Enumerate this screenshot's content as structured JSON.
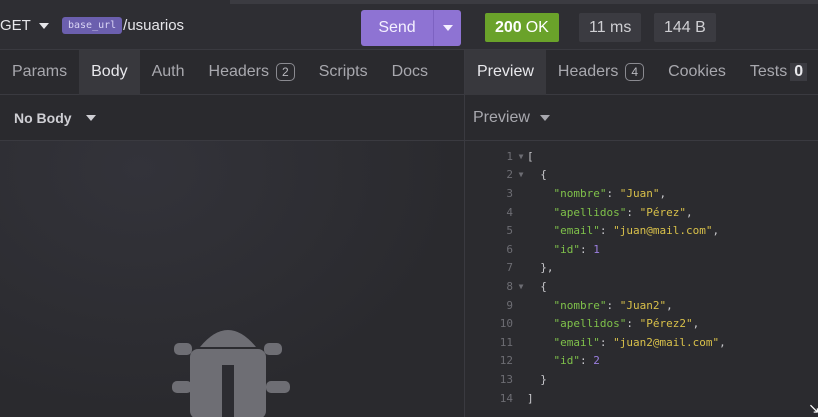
{
  "request": {
    "method": "GET",
    "url_variable": "base_url",
    "url_path": "/usuarios",
    "send_label": "Send"
  },
  "response": {
    "status_code": "200",
    "status_text": "OK",
    "time": "11 ms",
    "size": "144 B"
  },
  "left_tabs": [
    {
      "label": "Params",
      "badge": ""
    },
    {
      "label": "Body",
      "badge": ""
    },
    {
      "label": "Auth",
      "badge": ""
    },
    {
      "label": "Headers",
      "badge": "2"
    },
    {
      "label": "Scripts",
      "badge": ""
    },
    {
      "label": "Docs",
      "badge": ""
    }
  ],
  "right_tabs": [
    {
      "label": "Preview",
      "badge": ""
    },
    {
      "label": "Headers",
      "badge": "4"
    },
    {
      "label": "Cookies",
      "badge": ""
    },
    {
      "label": "Tests",
      "badge": "0"
    }
  ],
  "body_type": "No Body",
  "preview_mode": "Preview",
  "code_lines": [
    {
      "n": "1",
      "fold": true,
      "t": "["
    },
    {
      "n": "2",
      "fold": true,
      "t": "  {"
    },
    {
      "n": "3",
      "fold": false,
      "t": "    \"nombre\": \"Juan\","
    },
    {
      "n": "4",
      "fold": false,
      "t": "    \"apellidos\": \"Pérez\","
    },
    {
      "n": "5",
      "fold": false,
      "t": "    \"email\": \"juan@mail.com\","
    },
    {
      "n": "6",
      "fold": false,
      "t": "    \"id\": 1"
    },
    {
      "n": "7",
      "fold": false,
      "t": "  },"
    },
    {
      "n": "8",
      "fold": true,
      "t": "  {"
    },
    {
      "n": "9",
      "fold": false,
      "t": "    \"nombre\": \"Juan2\","
    },
    {
      "n": "10",
      "fold": false,
      "t": "    \"apellidos\": \"Pérez2\","
    },
    {
      "n": "11",
      "fold": false,
      "t": "    \"email\": \"juan2@mail.com\","
    },
    {
      "n": "12",
      "fold": false,
      "t": "    \"id\": 2"
    },
    {
      "n": "13",
      "fold": false,
      "t": "  }"
    },
    {
      "n": "14",
      "fold": false,
      "t": "]"
    }
  ],
  "colors": {
    "accent": "#8e73d3",
    "success": "#6aa22a"
  },
  "icons": {
    "empty_state": "bug-icon"
  }
}
